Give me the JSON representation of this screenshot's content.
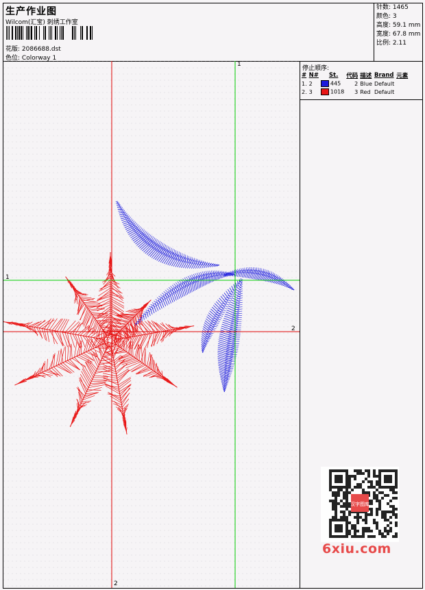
{
  "header": {
    "title": "生产作业图",
    "company": "Wilcom(汇宝) 刺绣工作室",
    "design_label": "花版:",
    "design_file": "2086688.dst",
    "colorway_label": "色位:",
    "colorway": "Colorway 1"
  },
  "stats": [
    {
      "label": "针数:",
      "value": "1465"
    },
    {
      "label": "颜色:",
      "value": "3"
    },
    {
      "label": "高度:",
      "value": "59.1 mm"
    },
    {
      "label": "宽度:",
      "value": "67.8 mm"
    },
    {
      "label": "比例:",
      "value": "2.11"
    }
  ],
  "sequence": {
    "title": "停止顺序:",
    "columns": [
      "#",
      "N#",
      "St.",
      "代码",
      "描述",
      "Brand",
      "元素"
    ],
    "rows": [
      {
        "idx": "1.",
        "n": "2",
        "color": "#1a1adc",
        "stitches": "445",
        "code": "2",
        "desc": "Blue",
        "brand": "Default"
      },
      {
        "idx": "2.",
        "n": "3",
        "color": "#e81515",
        "stitches": "1018",
        "code": "3",
        "desc": "Red",
        "brand": "Default"
      }
    ]
  },
  "axes": {
    "v1": "1",
    "h1": "1",
    "h2": "2",
    "v2": "2"
  },
  "colors": {
    "blue_thread": "#1a1adc",
    "red_thread": "#e81515",
    "green_axis": "#00cc00",
    "red_axis": "#e00000"
  },
  "watermark": {
    "qr_text": "汉字图库",
    "site": "6xiu.com"
  }
}
